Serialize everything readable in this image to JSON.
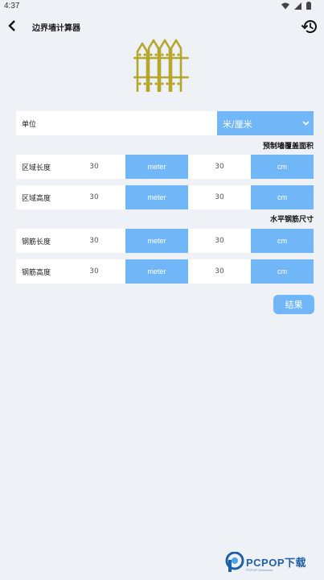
{
  "status_bar": {
    "time": "4:37",
    "icons": [
      "wifi-icon",
      "signal-icon",
      "battery-icon"
    ]
  },
  "app_bar": {
    "title": "边界墙计算器",
    "back_icon": "back-arrow-icon",
    "history_icon": "history-icon"
  },
  "header_image": "fence-icon",
  "unit_row": {
    "label": "单位",
    "selected": "米/厘米",
    "chevron": "⌄"
  },
  "section_area": {
    "title": "预制墙覆盖面积",
    "rows": [
      {
        "label": "区域长度",
        "value1": "30",
        "unit1": "meter",
        "value2": "30",
        "unit2": "cm"
      },
      {
        "label": "区域高度",
        "value1": "30",
        "unit1": "meter",
        "value2": "30",
        "unit2": "cm"
      }
    ]
  },
  "section_rebar": {
    "title": "水平钢筋尺寸",
    "rows": [
      {
        "label": "钢筋长度",
        "value1": "30",
        "unit1": "meter",
        "value2": "30",
        "unit2": "cm"
      },
      {
        "label": "钢筋高度",
        "value1": "30",
        "unit1": "meter",
        "value2": "30",
        "unit2": "cm"
      }
    ]
  },
  "result_button": "结果",
  "watermark": {
    "text": "PCPOP下载",
    "subtext": "PCPOP Download"
  },
  "colors": {
    "accent": "#71b7f7",
    "background": "#eef1f6",
    "fence": "#b5a62c",
    "watermark": "#1e5fa8"
  }
}
